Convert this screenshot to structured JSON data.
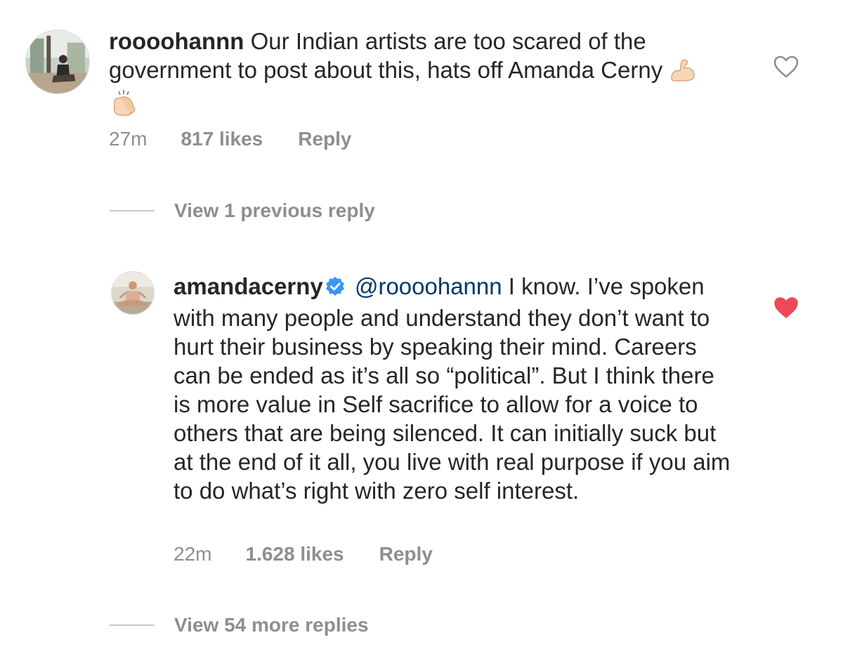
{
  "comments": [
    {
      "username": "roooohannn",
      "text": "Our Indian artists are too scared of the government to post about this, hats off Amanda Cerny",
      "emojis": [
        "flexed-biceps-icon",
        "clapping-hands-icon"
      ],
      "time": "27m",
      "likes": "817 likes",
      "reply_label": "Reply",
      "liked": false
    },
    {
      "username": "amandacerny",
      "verified": true,
      "mention": "@roooohannn",
      "text": "I know. I’ve spoken with many people and understand they don’t want to hurt their business by speaking their mind. Careers can be ended as it’s all so “political”. But I think there is more value in Self sacrifice to allow for a voice to others that are being silenced. It can initially suck but at the end of it all, you live with real purpose if you aim to do what’s right with zero self interest.",
      "time": "22m",
      "likes": "1.628 likes",
      "reply_label": "Reply",
      "liked": true
    }
  ],
  "view_previous": "View 1 previous reply",
  "view_more": "View 54 more replies",
  "colors": {
    "text": "#262626",
    "secondary": "#8e8e8e",
    "mention": "#00376b",
    "liked": "#ed4956",
    "verified": "#3897f0"
  }
}
